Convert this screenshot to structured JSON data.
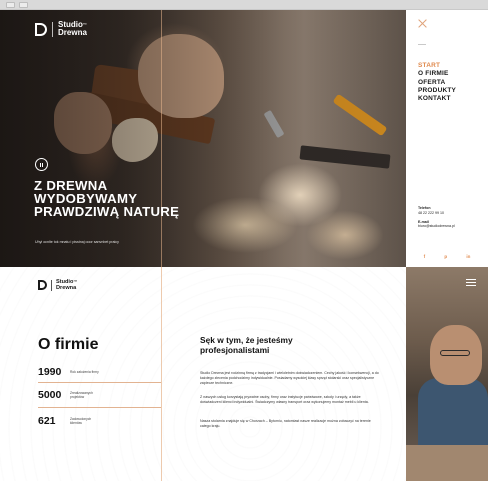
{
  "hero": {
    "brand_line1": "Studio",
    "brand_tm": "™",
    "brand_line2": "Drewna",
    "title": "Z DREWNA WYDOBYWAMY PRAWDZIWĄ NATURĘ",
    "subtitle": "Uhyi ocnlte tok mnatu i pisstnaj ooor sanvnbet praicy"
  },
  "sidebar": {
    "nav": [
      "START",
      "O FIRMIE",
      "OFERTA",
      "PRODUKTY",
      "KONTAKT"
    ],
    "active_index": 0,
    "phone_label": "Telefon",
    "phone": "48 22 222 99 10",
    "email_label": "E-mail",
    "email": "biuro@studiodrewna.pl",
    "social": [
      "f",
      "p",
      "in"
    ]
  },
  "about": {
    "brand_line1": "Studio",
    "brand_tm": "™",
    "brand_line2": "Drewna",
    "title": "O firmie",
    "stats": [
      {
        "number": "1990",
        "label": "Rok założenia firmy"
      },
      {
        "number": "5000",
        "label": "Zrealizowanych projektów"
      },
      {
        "number": "621",
        "label": "Zadowolonych klientów"
      }
    ],
    "section_title": "Sęk w tym, że jesteśmy profesjonalistami",
    "paragraphs": [
      "Studio Drewna jest rodzinną firmą z tradycjami i wieloletnim doświadczeniem. Cechy jakość i konsekwencji, a do każdego zlecenia podchodzimy indywidualnie. Posiadamy wysokiej klasy sprzęt stolarski oraz specjalistyczne zaplecze techniczne.",
      "Z naszych usług korzystają prywatne osoby, firmy oraz instytucje państwowe, szkoły i urzędy, a także doświadczeni klienci indywidualni. Świadczymy własny transport oraz wykonujemy montaż mebli u klienta.",
      "Nasza stolarnia znajduje się w Chorzach – Bytomiu, natomiast nasze realizacje można zobaczyć na terenie całego kraju."
    ]
  },
  "colors": {
    "accent": "#e08a4e",
    "dark": "#1a1a1a",
    "divider": "#e2b391"
  },
  "icons": {
    "close": "close-icon",
    "pause": "pause-icon",
    "menu": "hamburger-icon"
  }
}
